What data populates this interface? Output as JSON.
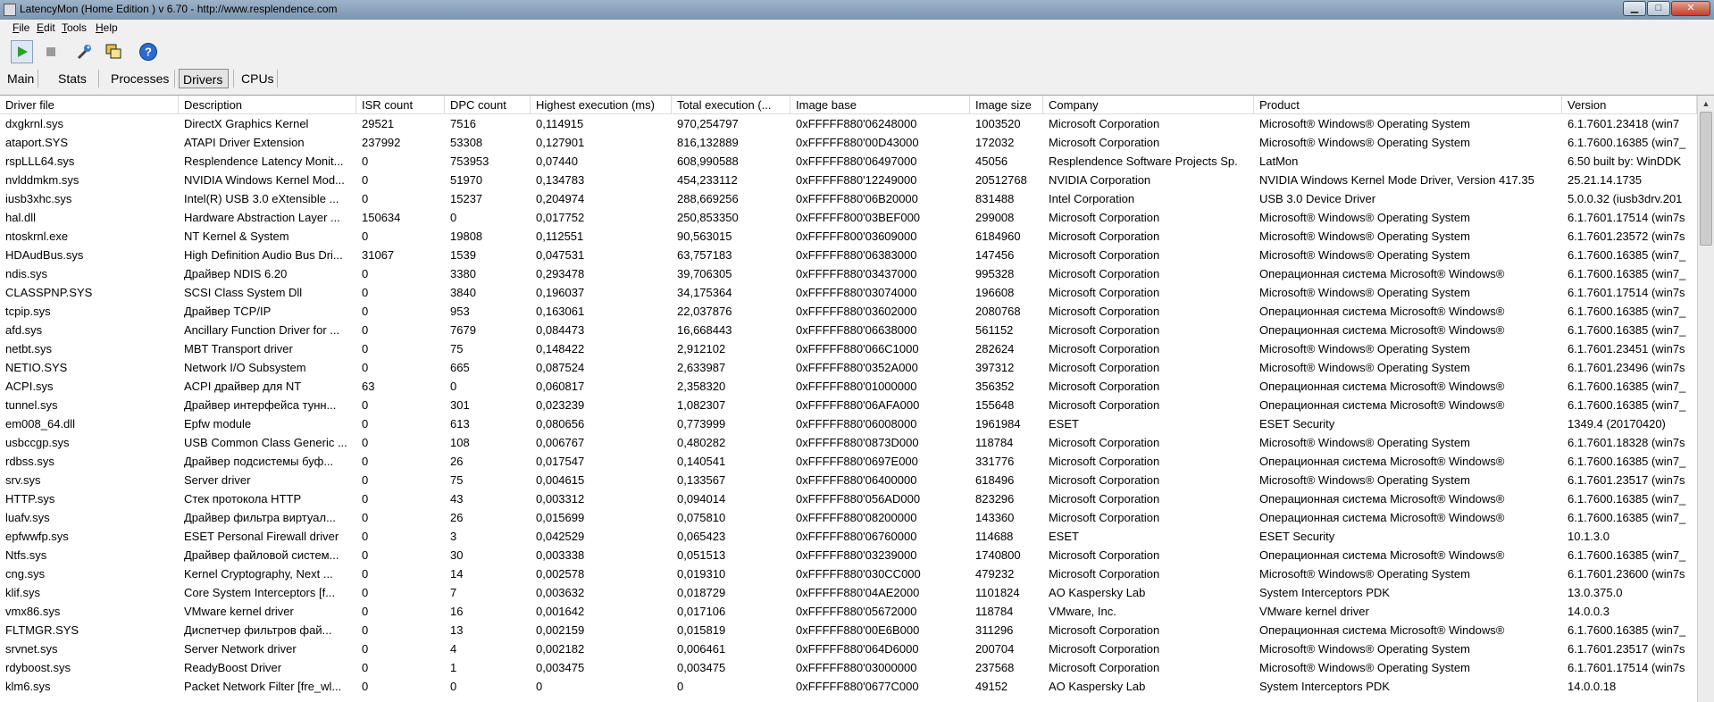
{
  "window": {
    "title": "LatencyMon  (Home Edition )  v 6.70 - http://www.resplendence.com",
    "min_symbol": "▁",
    "max_symbol": "□",
    "close_symbol": "✕"
  },
  "menu": [
    {
      "accel": "F",
      "rest": "ile"
    },
    {
      "accel": "E",
      "rest": "dit"
    },
    {
      "accel": "T",
      "rest": "ools"
    },
    {
      "accel": "H",
      "rest": "elp"
    }
  ],
  "toolbar": {
    "buttons": [
      "play-icon",
      "stop-icon",
      "wrench-icon",
      "copy-window-icon",
      "help-icon"
    ],
    "help_glyph": "?"
  },
  "tabs": [
    {
      "label": "Main",
      "selected": false
    },
    {
      "label": "Stats",
      "selected": false
    },
    {
      "label": "Processes",
      "selected": false
    },
    {
      "label": "Drivers",
      "selected": true
    },
    {
      "label": "CPUs",
      "selected": false
    }
  ],
  "table": {
    "columns": [
      "Driver file",
      "Description",
      "ISR count",
      "DPC count",
      "Highest execution (ms)",
      "Total execution (...",
      "Image base",
      "Image size",
      "Company",
      "Product",
      "Version"
    ],
    "rows": [
      [
        "dxgkrnl.sys",
        "DirectX Graphics Kernel",
        "29521",
        "7516",
        "0,114915",
        "970,254797",
        "0xFFFFF880'06248000",
        "1003520",
        "Microsoft Corporation",
        "Microsoft® Windows® Operating System",
        "6.1.7601.23418 (win7"
      ],
      [
        "ataport.SYS",
        "ATAPI Driver Extension",
        "237992",
        "53308",
        "0,127901",
        "816,132889",
        "0xFFFFF880'00D43000",
        "172032",
        "Microsoft Corporation",
        "Microsoft® Windows® Operating System",
        "6.1.7600.16385 (win7_"
      ],
      [
        "rspLLL64.sys",
        "Resplendence Latency Monit...",
        "0",
        "753953",
        "0,07440",
        "608,990588",
        "0xFFFFF880'06497000",
        "45056",
        "Resplendence Software Projects Sp.",
        "LatMon",
        "6.50 built by: WinDDK"
      ],
      [
        "nvlddmkm.sys",
        "NVIDIA Windows Kernel Mod...",
        "0",
        "51970",
        "0,134783",
        "454,233112",
        "0xFFFFF880'12249000",
        "20512768",
        "NVIDIA Corporation",
        "NVIDIA Windows Kernel Mode Driver, Version 417.35",
        "25.21.14.1735"
      ],
      [
        "iusb3xhc.sys",
        "Intel(R) USB 3.0 eXtensible ...",
        "0",
        "15237",
        "0,204974",
        "288,669256",
        "0xFFFFF880'06B20000",
        "831488",
        "Intel Corporation",
        "USB 3.0 Device Driver",
        "5.0.0.32 (iusb3drv.201"
      ],
      [
        "hal.dll",
        "Hardware Abstraction Layer ...",
        "150634",
        "0",
        "0,017752",
        "250,853350",
        "0xFFFFF800'03BEF000",
        "299008",
        "Microsoft Corporation",
        "Microsoft® Windows® Operating System",
        "6.1.7601.17514 (win7s"
      ],
      [
        "ntoskrnl.exe",
        "NT Kernel & System",
        "0",
        "19808",
        "0,112551",
        "90,563015",
        "0xFFFFF800'03609000",
        "6184960",
        "Microsoft Corporation",
        "Microsoft® Windows® Operating System",
        "6.1.7601.23572 (win7s"
      ],
      [
        "HDAudBus.sys",
        "High Definition Audio Bus Dri...",
        "31067",
        "1539",
        "0,047531",
        "63,757183",
        "0xFFFFF880'06383000",
        "147456",
        "Microsoft Corporation",
        "Microsoft® Windows® Operating System",
        "6.1.7600.16385 (win7_"
      ],
      [
        "ndis.sys",
        "Драйвер NDIS 6.20",
        "0",
        "3380",
        "0,293478",
        "39,706305",
        "0xFFFFF880'03437000",
        "995328",
        "Microsoft Corporation",
        "Операционная система Microsoft® Windows®",
        "6.1.7600.16385 (win7_"
      ],
      [
        "CLASSPNP.SYS",
        "SCSI Class System Dll",
        "0",
        "3840",
        "0,196037",
        "34,175364",
        "0xFFFFF880'03074000",
        "196608",
        "Microsoft Corporation",
        "Microsoft® Windows® Operating System",
        "6.1.7601.17514 (win7s"
      ],
      [
        "tcpip.sys",
        "Драйвер TCP/IP",
        "0",
        "953",
        "0,163061",
        "22,037876",
        "0xFFFFF880'03602000",
        "2080768",
        "Microsoft Corporation",
        "Операционная система Microsoft® Windows®",
        "6.1.7600.16385 (win7_"
      ],
      [
        "afd.sys",
        "Ancillary Function Driver for ...",
        "0",
        "7679",
        "0,084473",
        "16,668443",
        "0xFFFFF880'06638000",
        "561152",
        "Microsoft Corporation",
        "Операционная система Microsoft® Windows®",
        "6.1.7600.16385 (win7_"
      ],
      [
        "netbt.sys",
        "MBT Transport driver",
        "0",
        "75",
        "0,148422",
        "2,912102",
        "0xFFFFF880'066C1000",
        "282624",
        "Microsoft Corporation",
        "Microsoft® Windows® Operating System",
        "6.1.7601.23451 (win7s"
      ],
      [
        "NETIO.SYS",
        "Network I/O Subsystem",
        "0",
        "665",
        "0,087524",
        "2,633987",
        "0xFFFFF880'0352A000",
        "397312",
        "Microsoft Corporation",
        "Microsoft® Windows® Operating System",
        "6.1.7601.23496 (win7s"
      ],
      [
        "ACPI.sys",
        "ACPI драйвер для NT",
        "63",
        "0",
        "0,060817",
        "2,358320",
        "0xFFFFF880'01000000",
        "356352",
        "Microsoft Corporation",
        "Операционная система Microsoft® Windows®",
        "6.1.7600.16385 (win7_"
      ],
      [
        "tunnel.sys",
        "Драйвер интерфейса тунн...",
        "0",
        "301",
        "0,023239",
        "1,082307",
        "0xFFFFF880'06AFA000",
        "155648",
        "Microsoft Corporation",
        "Операционная система Microsoft® Windows®",
        "6.1.7600.16385 (win7_"
      ],
      [
        "em008_64.dll",
        "Epfw module",
        "0",
        "613",
        "0,080656",
        "0,773999",
        "0xFFFFF880'06008000",
        "1961984",
        "ESET",
        "ESET Security",
        "1349.4 (20170420)"
      ],
      [
        "usbccgp.sys",
        "USB Common Class Generic ...",
        "0",
        "108",
        "0,006767",
        "0,480282",
        "0xFFFFF880'0873D000",
        "118784",
        "Microsoft Corporation",
        "Microsoft® Windows® Operating System",
        "6.1.7601.18328 (win7s"
      ],
      [
        "rdbss.sys",
        "Драйвер подсистемы буф...",
        "0",
        "26",
        "0,017547",
        "0,140541",
        "0xFFFFF880'0697E000",
        "331776",
        "Microsoft Corporation",
        "Операционная система Microsoft® Windows®",
        "6.1.7600.16385 (win7_"
      ],
      [
        "srv.sys",
        "Server driver",
        "0",
        "75",
        "0,004615",
        "0,133567",
        "0xFFFFF880'06400000",
        "618496",
        "Microsoft Corporation",
        "Microsoft® Windows® Operating System",
        "6.1.7601.23517 (win7s"
      ],
      [
        "HTTP.sys",
        "Стек протокола HTTP",
        "0",
        "43",
        "0,003312",
        "0,094014",
        "0xFFFFF880'056AD000",
        "823296",
        "Microsoft Corporation",
        "Операционная система Microsoft® Windows®",
        "6.1.7600.16385 (win7_"
      ],
      [
        "luafv.sys",
        "Драйвер фильтра виртуал...",
        "0",
        "26",
        "0,015699",
        "0,075810",
        "0xFFFFF880'08200000",
        "143360",
        "Microsoft Corporation",
        "Операционная система Microsoft® Windows®",
        "6.1.7600.16385 (win7_"
      ],
      [
        "epfwwfp.sys",
        "ESET Personal Firewall driver",
        "0",
        "3",
        "0,042529",
        "0,065423",
        "0xFFFFF880'06760000",
        "114688",
        "ESET",
        "ESET Security",
        "10.1.3.0"
      ],
      [
        "Ntfs.sys",
        "Драйвер файловой систем...",
        "0",
        "30",
        "0,003338",
        "0,051513",
        "0xFFFFF880'03239000",
        "1740800",
        "Microsoft Corporation",
        "Операционная система Microsoft® Windows®",
        "6.1.7600.16385 (win7_"
      ],
      [
        "cng.sys",
        "Kernel Cryptography, Next ...",
        "0",
        "14",
        "0,002578",
        "0,019310",
        "0xFFFFF880'030CC000",
        "479232",
        "Microsoft Corporation",
        "Microsoft® Windows® Operating System",
        "6.1.7601.23600 (win7s"
      ],
      [
        "klif.sys",
        "Core System Interceptors [f...",
        "0",
        "7",
        "0,003632",
        "0,018729",
        "0xFFFFF880'04AE2000",
        "1101824",
        "AO Kaspersky Lab",
        "System Interceptors PDK",
        "13.0.375.0"
      ],
      [
        "vmx86.sys",
        "VMware kernel driver",
        "0",
        "16",
        "0,001642",
        "0,017106",
        "0xFFFFF880'05672000",
        "118784",
        "VMware, Inc.",
        "VMware kernel driver",
        "14.0.0.3"
      ],
      [
        "FLTMGR.SYS",
        "Диспетчер фильтров фай...",
        "0",
        "13",
        "0,002159",
        "0,015819",
        "0xFFFFF880'00E6B000",
        "311296",
        "Microsoft Corporation",
        "Операционная система Microsoft® Windows®",
        "6.1.7600.16385 (win7_"
      ],
      [
        "srvnet.sys",
        "Server Network driver",
        "0",
        "4",
        "0,002182",
        "0,006461",
        "0xFFFFF880'064D6000",
        "200704",
        "Microsoft Corporation",
        "Microsoft® Windows® Operating System",
        "6.1.7601.23517 (win7s"
      ],
      [
        "rdyboost.sys",
        "ReadyBoost Driver",
        "0",
        "1",
        "0,003475",
        "0,003475",
        "0xFFFFF880'03000000",
        "237568",
        "Microsoft Corporation",
        "Microsoft® Windows® Operating System",
        "6.1.7601.17514 (win7s"
      ],
      [
        "klm6.sys",
        "Packet Network Filter [fre_wl...",
        "0",
        "0",
        "0",
        "0",
        "0xFFFFF880'0677C000",
        "49152",
        "AO Kaspersky Lab",
        "System Interceptors PDK",
        "14.0.0.18"
      ]
    ]
  },
  "scrollbar": {
    "up_arrow": "▲"
  },
  "colors": {
    "titlebar": "#8aa2bd",
    "selected_tab": "#e4e4e4",
    "grid_bg": "#ffffff",
    "play_green": "#2e9e2e",
    "help_blue": "#2a6bd1"
  }
}
